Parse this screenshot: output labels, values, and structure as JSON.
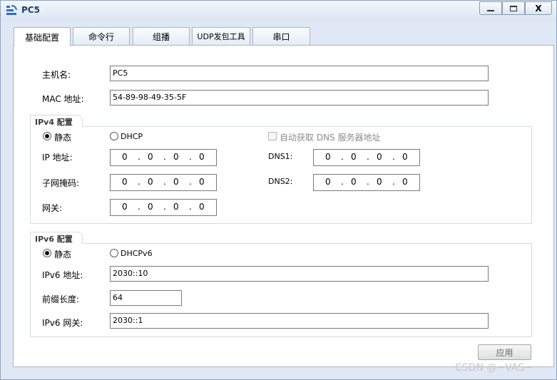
{
  "window": {
    "title": "PC5",
    "icon": "pc-app-icon",
    "minimize_glyph": "—",
    "maximize_glyph": "□",
    "close_glyph": "X"
  },
  "tabs": [
    {
      "label": "基础配置",
      "active": true
    },
    {
      "label": "命令行",
      "active": false
    },
    {
      "label": "组播",
      "active": false
    },
    {
      "label": "UDP发包工具",
      "active": false
    },
    {
      "label": "串口",
      "active": false
    }
  ],
  "basic": {
    "hostname_label": "主机名:",
    "hostname_value": "PC5",
    "mac_label": "MAC 地址:",
    "mac_value": "54-89-98-49-35-5F"
  },
  "ipv4": {
    "group_title": "IPv4 配置",
    "static_label": "静态",
    "dhcp_label": "DHCP",
    "static_selected": true,
    "auto_dns_label": "自动获取 DNS 服务器地址",
    "ip_label": "IP 地址:",
    "ip_octets": [
      "0",
      "0",
      "0",
      "0"
    ],
    "mask_label": "子网掩码:",
    "mask_octets": [
      "0",
      "0",
      "0",
      "0"
    ],
    "gateway_label": "网关:",
    "gateway_octets": [
      "0",
      "0",
      "0",
      "0"
    ],
    "dns1_label": "DNS1:",
    "dns1_octets": [
      "0",
      "0",
      "0",
      "0"
    ],
    "dns2_label": "DNS2:",
    "dns2_octets": [
      "0",
      "0",
      "0",
      "0"
    ]
  },
  "ipv6": {
    "group_title": "IPv6 配置",
    "static_label": "静态",
    "dhcp_label": "DHCPv6",
    "static_selected": true,
    "address_label": "IPv6 地址:",
    "address_value": "2030::10",
    "prefix_label": "前缀长度:",
    "prefix_value": "64",
    "gateway_label": "IPv6 网关:",
    "gateway_value": "2030::1"
  },
  "actions": {
    "apply_label": "应用"
  },
  "watermark": "CSDN @~VAS~"
}
